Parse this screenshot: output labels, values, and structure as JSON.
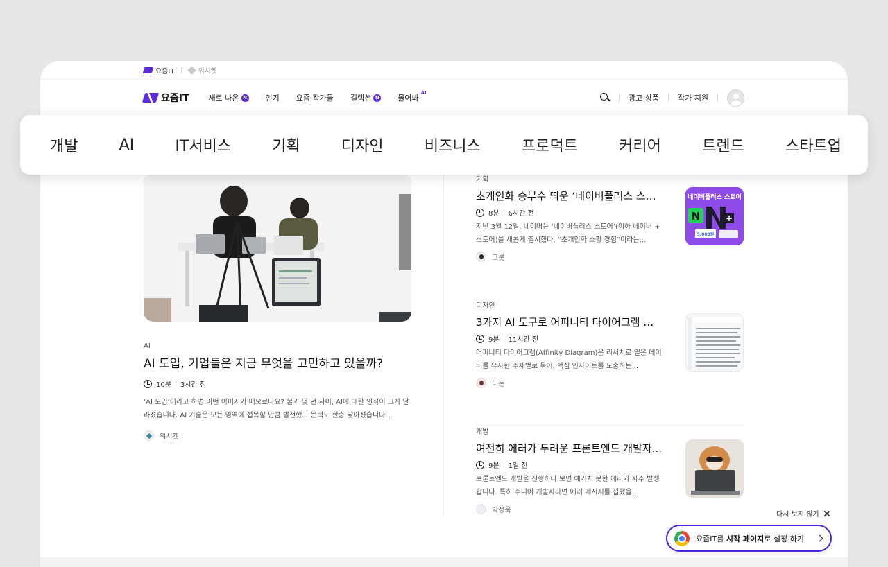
{
  "topstrip": {
    "brand": "요즘IT",
    "partner": "위시켓"
  },
  "header": {
    "logo": "요즘IT",
    "nav": [
      {
        "label": "새로 나온",
        "badge": "N"
      },
      {
        "label": "인기",
        "badge": ""
      },
      {
        "label": "요즘 작가들",
        "badge": ""
      },
      {
        "label": "컬렉션",
        "badge": "N"
      },
      {
        "label": "물어봐",
        "badge": "AI"
      }
    ],
    "ad_products": "광고 상품",
    "writer_apply": "작가 지원"
  },
  "categories": [
    "개발",
    "AI",
    "IT서비스",
    "기획",
    "디자인",
    "비즈니스",
    "프로덕트",
    "커리어",
    "트렌드",
    "스타트업"
  ],
  "featured": {
    "category": "AI",
    "title": "AI 도입, 기업들은 지금 무엇을 고민하고 있을까?",
    "read_time": "10분",
    "posted": "3시간 전",
    "description": "‘AI 도입’이라고 하면 어떤 이미지가 떠오르나요? 불과 몇 년 사이, AI에 대한 인식이 크게 달라졌습니다. AI 기술은 모든 영역에 접목할 만큼 발전했고 문턱도 한층 낮아졌습니다....",
    "author": "위시켓"
  },
  "articles": [
    {
      "category": "기획",
      "title": "초개인화 승부수 띄운 ‘네이버플러스 스토...",
      "read_time": "8분",
      "posted": "6시간 전",
      "description": "지난 3월 12일, 네이버는 ‘네이버플러스 스토어’(이하 네이버 + 스토어)를 새롭게 출시했다. “초개인화 쇼핑 경험”이라는...",
      "author": "그릇",
      "thumb_text": "네이버플러스 스토어",
      "thumb_price": "5,000원"
    },
    {
      "category": "디자인",
      "title": "3가지 AI 도구로 어피니티 다이어그램 만...",
      "read_time": "9분",
      "posted": "11시간 전",
      "description": "어피니티 다이어그램(Affinity Diagram)은 리서치로 얻은 데이터를 유사한 주제별로 묶어, 핵심 인사이트를 도출하는...",
      "author": "디논"
    },
    {
      "category": "개발",
      "title": "여전히 에러가 두려운 프론트엔드 개발자...",
      "read_time": "9분",
      "posted": "1일 전",
      "description": "프론트엔드 개발을 진행하다 보면 예기치 못한 에러가 자주 발생합니다. 특히 주니어 개발자라면 에러 메시지를 접했을...",
      "author": "박정욱"
    }
  ],
  "popup": {
    "dismiss": "다시 보지 않기",
    "cta_prefix": "요즘IT를 ",
    "cta_bold": "시작 페이지",
    "cta_suffix": "로 설정 하기"
  },
  "colors": {
    "brand": "#5b2bd9",
    "cta_border": "#4a23d6"
  }
}
